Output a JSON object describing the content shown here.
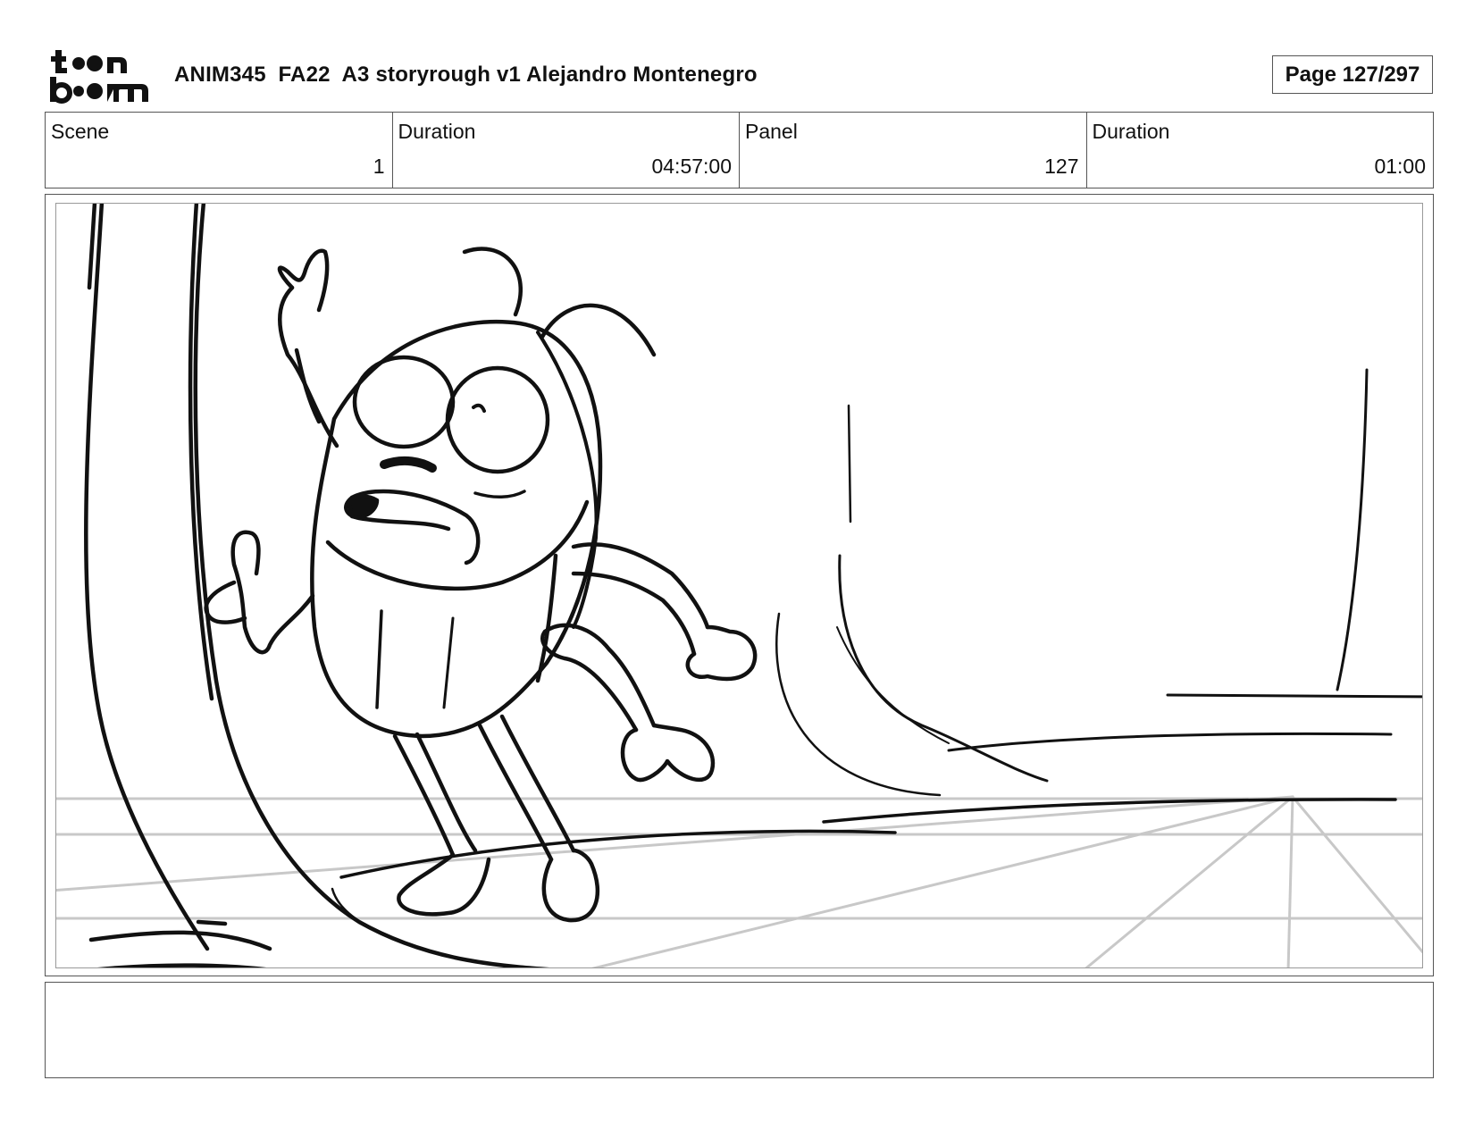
{
  "header": {
    "logo_text": "toon boom",
    "title": "ANIM345  FA22  A3 storyrough v1 Alejandro Montenegro",
    "page": "Page 127/297"
  },
  "info": {
    "scene_label": "Scene",
    "scene_value": "1",
    "scene_duration_label": "Duration",
    "scene_duration_value": "04:57:00",
    "panel_label": "Panel",
    "panel_value": "127",
    "panel_duration_label": "Duration",
    "panel_duration_value": "01:00"
  },
  "panel": {
    "sketch_icon": "storyboard-sketch-icon",
    "ink_color": "#111111",
    "guide_color": "#c8c8c8"
  },
  "notes": {
    "text": ""
  }
}
